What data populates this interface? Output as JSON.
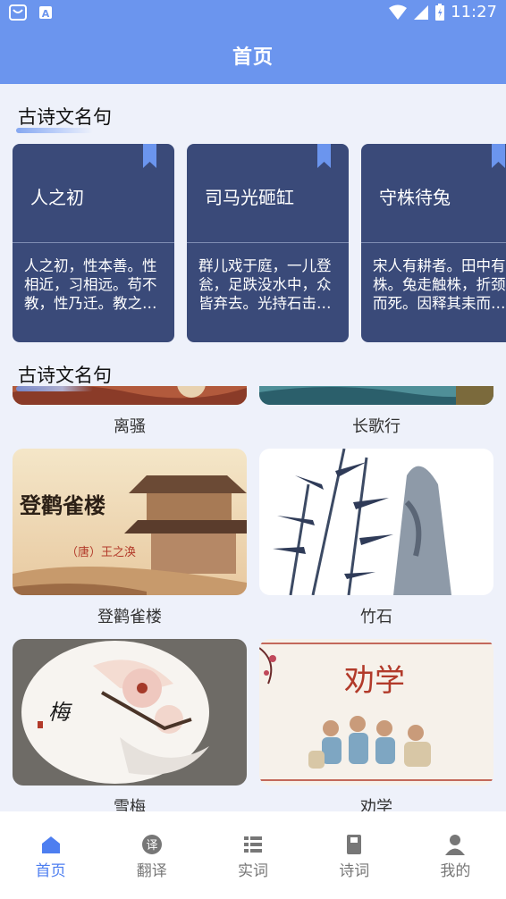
{
  "status_bar": {
    "time": "11:27"
  },
  "header": {
    "title": "首页"
  },
  "sections": [
    {
      "title": "古诗文名句"
    },
    {
      "title": "古诗文名句"
    }
  ],
  "cards": [
    {
      "title": "人之初",
      "text": "人之初，性本善。性相近，习相远。苟不教，性乃迁。教之道，贵以专。"
    },
    {
      "title": "司马光砸缸",
      "text": "群儿戏于庭，一儿登瓮，足跌没水中，众皆弃去。光持石击瓮破之，水迸，儿得活。"
    },
    {
      "title": "守株待兔",
      "text": "宋人有耕者。田中有株。兔走触株，折颈而死。因释其耒而守株，冀复得兔。"
    }
  ],
  "poems": [
    {
      "title": "离骚",
      "art_text": ""
    },
    {
      "title": "长歌行",
      "art_text": ""
    },
    {
      "title": "登鹳雀楼",
      "art_text": "登鹳雀楼",
      "art_subtext": "（唐）王之涣"
    },
    {
      "title": "竹石",
      "art_text": ""
    },
    {
      "title": "雪梅",
      "art_text": "梅"
    },
    {
      "title": "劝学",
      "art_text": "劝学"
    }
  ],
  "nav": [
    {
      "label": "首页",
      "icon": "home-icon",
      "active": true
    },
    {
      "label": "翻译",
      "icon": "translate-icon",
      "active": false
    },
    {
      "label": "实词",
      "icon": "list-icon",
      "active": false
    },
    {
      "label": "诗词",
      "icon": "book-icon",
      "active": false
    },
    {
      "label": "我的",
      "icon": "user-icon",
      "active": false
    }
  ],
  "colors": {
    "accent": "#6b95ee",
    "card_bg": "#3a4a79",
    "nav_active": "#4d7ef0"
  }
}
